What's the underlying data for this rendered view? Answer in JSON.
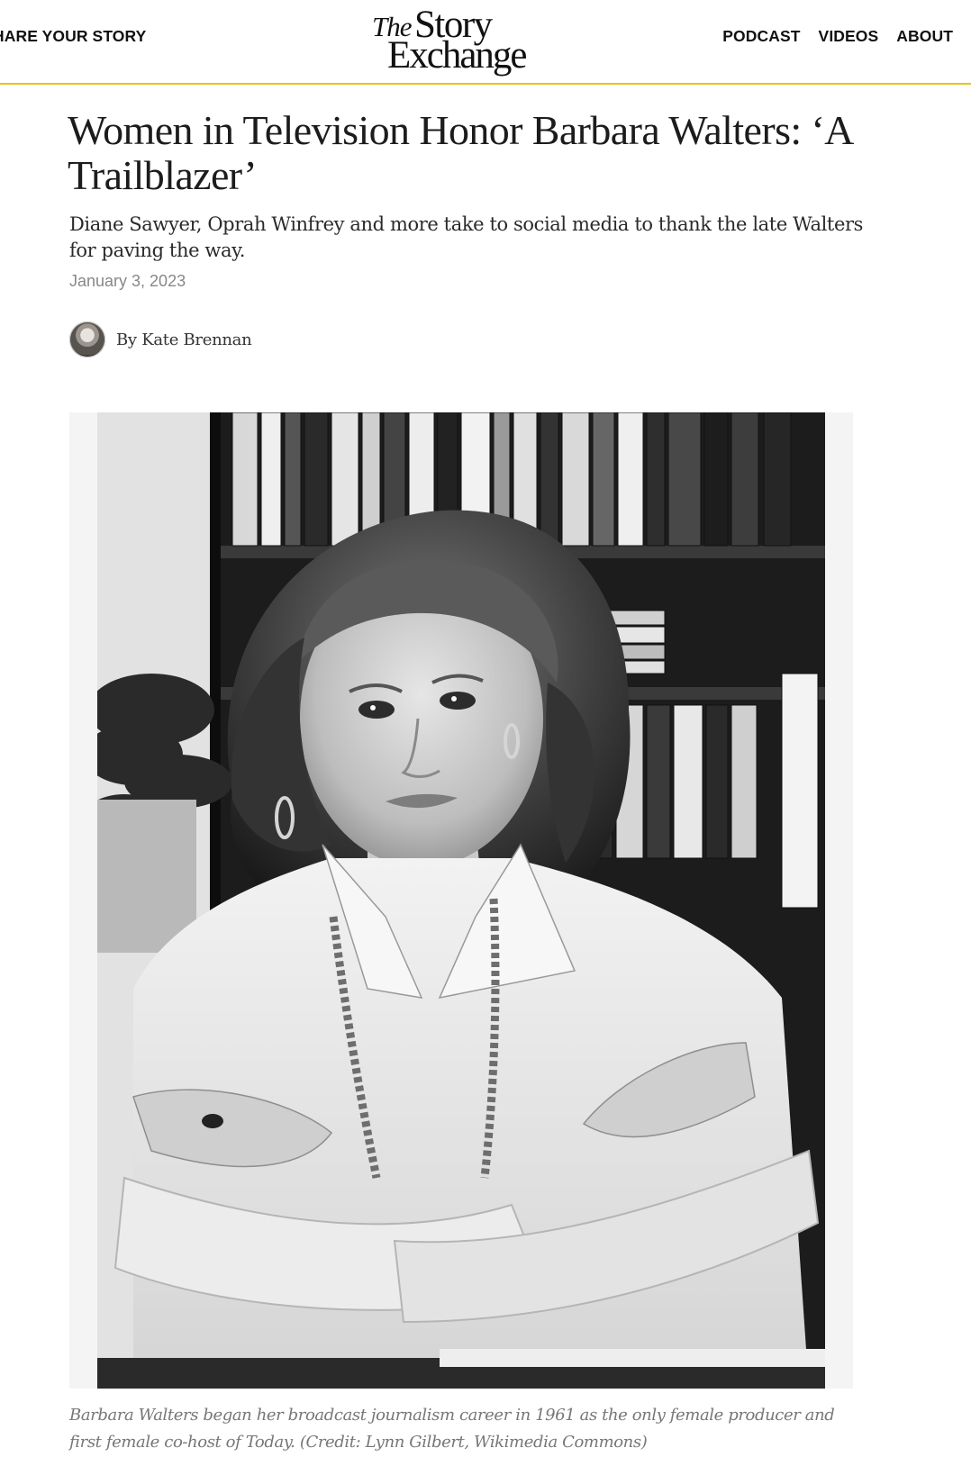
{
  "header": {
    "nav_left": {
      "share_label": "HARE YOUR STORY"
    },
    "logo": {
      "the": "The",
      "story": "Story",
      "exchange": "Exchange"
    },
    "nav_right": [
      {
        "label": "PODCAST"
      },
      {
        "label": "VIDEOS"
      },
      {
        "label": "ABOUT"
      }
    ]
  },
  "article": {
    "headline": "Women in Television Honor Barbara Walters: ‘A Trailblazer’",
    "deck": "Diane Sawyer, Oprah Winfrey and more take to social media to thank the late Walters for paving the way.",
    "date": "January 3, 2023",
    "byline": {
      "prefix": "By ",
      "author": "Kate Brennan"
    },
    "hero": {
      "caption": "Barbara Walters began her broadcast journalism career in 1961 as the only female producer and first female co-host of Today. (Credit: Lynn Gilbert, Wikimedia Commons)"
    }
  },
  "colors": {
    "header_rule": "#e6c419",
    "figure_bg": "#f4f4f4",
    "caption_text": "#777777",
    "date_text": "#888888"
  }
}
